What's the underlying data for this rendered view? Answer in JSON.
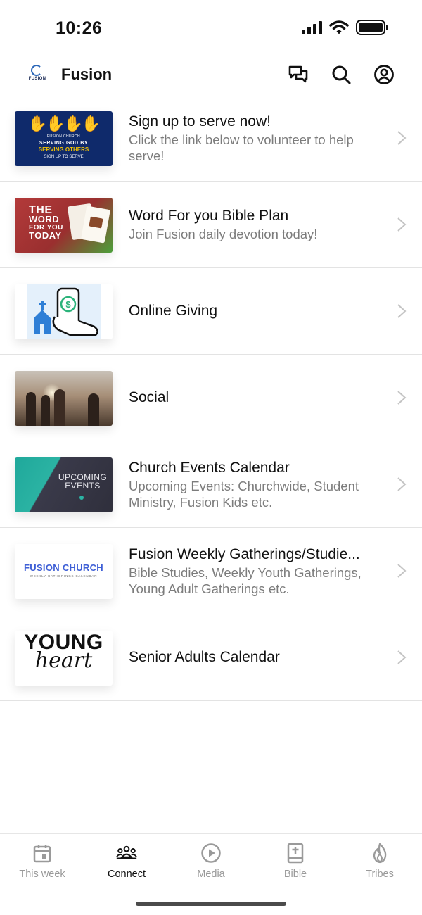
{
  "status_bar": {
    "time": "10:26"
  },
  "header": {
    "logo_text": "FUSION",
    "title": "Fusion",
    "icons": [
      "chat-icon",
      "search-icon",
      "profile-icon"
    ]
  },
  "list": [
    {
      "title": "Sign up to serve now!",
      "subtitle": "Click the link below to volunteer to help serve!",
      "thumb_text": {
        "church": "FUSION CHURCH",
        "line1": "SERVING GOD BY",
        "line2": "SERVING OTHERS",
        "line3": "SIGN UP TO SERVE"
      }
    },
    {
      "title": "Word For you Bible Plan",
      "subtitle": "Join Fusion daily devotion today!",
      "thumb_text": {
        "line1": "THE",
        "line2": "WORD",
        "line3": "FOR YOU",
        "line4": "TODAY"
      }
    },
    {
      "title": "Online Giving",
      "subtitle": ""
    },
    {
      "title": "Social",
      "subtitle": ""
    },
    {
      "title": "Church Events Calendar",
      "subtitle": "Upcoming Events: Churchwide, Student Ministry, Fusion Kids etc.",
      "thumb_text": {
        "line1": "UPCOMING",
        "line2": "EVENTS"
      }
    },
    {
      "title": "Fusion Weekly Gatherings/Studie...",
      "subtitle": "Bible Studies, Weekly Youth Gatherings, Young Adult Gatherings etc.",
      "thumb_text": {
        "line1": "FUSION CHURCH",
        "line2": "WEEKLY GATHERINGS CALENDAR"
      }
    },
    {
      "title": "Senior Adults Calendar",
      "subtitle": "",
      "thumb_text": {
        "line1": "YOUNG",
        "line2": "heart"
      }
    }
  ],
  "tabs": [
    {
      "label": "This week",
      "icon": "calendar-icon",
      "active": false
    },
    {
      "label": "Connect",
      "icon": "people-icon",
      "active": true
    },
    {
      "label": "Media",
      "icon": "play-icon",
      "active": false
    },
    {
      "label": "Bible",
      "icon": "bible-icon",
      "active": false
    },
    {
      "label": "Tribes",
      "icon": "flame-icon",
      "active": false
    }
  ],
  "colors": {
    "active_tab": "#111111",
    "inactive_tab": "#9a9a9a",
    "subtitle": "#7c7c7c",
    "divider": "#e3e3e3"
  }
}
